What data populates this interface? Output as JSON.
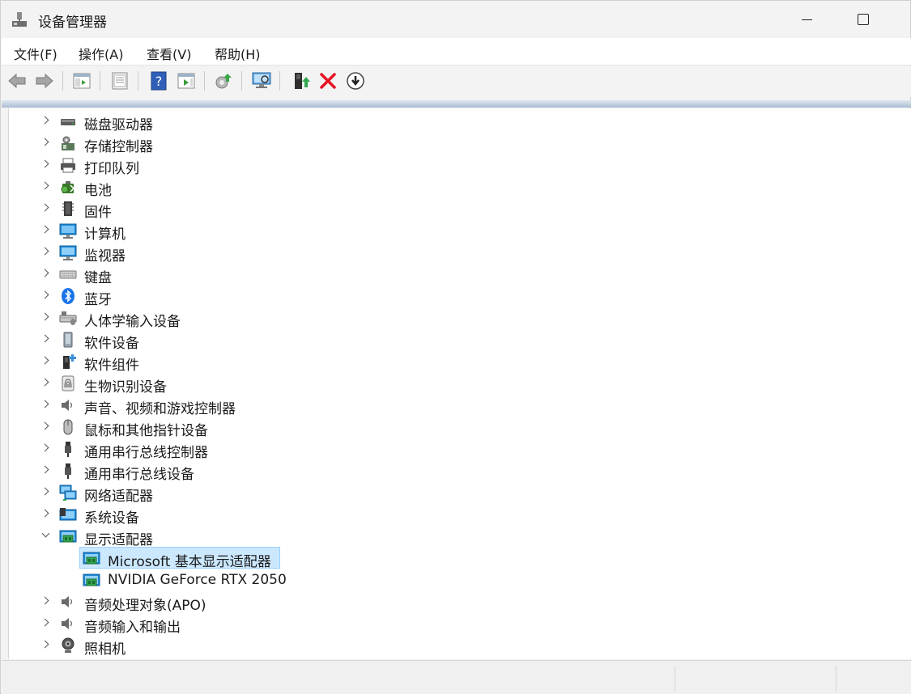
{
  "window": {
    "title": "设备管理器",
    "icon": "device-manager-icon"
  },
  "menu": [
    {
      "label": "文件(F)"
    },
    {
      "label": "操作(A)"
    },
    {
      "label": "查看(V)"
    },
    {
      "label": "帮助(H)"
    }
  ],
  "toolbar": [
    {
      "icon": "back-arrow-icon"
    },
    {
      "icon": "forward-arrow-icon"
    },
    {
      "icon": "show-hide-console-tree-icon"
    },
    {
      "icon": "properties-icon"
    },
    {
      "icon": "help-icon"
    },
    {
      "icon": "run-icon"
    },
    {
      "icon": "update-driver-icon"
    },
    {
      "icon": "scan-hardware-icon"
    },
    {
      "icon": "enable-device-icon"
    },
    {
      "icon": "uninstall-device-icon"
    },
    {
      "icon": "disable-device-icon"
    }
  ],
  "tree": {
    "items": [
      {
        "label": "磁盘驱动器",
        "icon": "disk-drive-icon",
        "expanded": false
      },
      {
        "label": "存储控制器",
        "icon": "storage-controller-icon",
        "expanded": false
      },
      {
        "label": "打印队列",
        "icon": "printer-icon",
        "expanded": false
      },
      {
        "label": "电池",
        "icon": "battery-icon",
        "expanded": false
      },
      {
        "label": "固件",
        "icon": "firmware-icon",
        "expanded": false
      },
      {
        "label": "计算机",
        "icon": "computer-icon",
        "expanded": false
      },
      {
        "label": "监视器",
        "icon": "monitor-icon",
        "expanded": false
      },
      {
        "label": "键盘",
        "icon": "keyboard-icon",
        "expanded": false
      },
      {
        "label": "蓝牙",
        "icon": "bluetooth-icon",
        "expanded": false
      },
      {
        "label": "人体学输入设备",
        "icon": "hid-icon",
        "expanded": false
      },
      {
        "label": "软件设备",
        "icon": "software-device-icon",
        "expanded": false
      },
      {
        "label": "软件组件",
        "icon": "software-component-icon",
        "expanded": false
      },
      {
        "label": "生物识别设备",
        "icon": "fingerprint-icon",
        "expanded": false
      },
      {
        "label": "声音、视频和游戏控制器",
        "icon": "speaker-icon",
        "expanded": false
      },
      {
        "label": "鼠标和其他指针设备",
        "icon": "mouse-icon",
        "expanded": false
      },
      {
        "label": "通用串行总线控制器",
        "icon": "usb-icon",
        "expanded": false
      },
      {
        "label": "通用串行总线设备",
        "icon": "usb-icon",
        "expanded": false
      },
      {
        "label": "网络适配器",
        "icon": "network-adapter-icon",
        "expanded": false
      },
      {
        "label": "系统设备",
        "icon": "system-device-icon",
        "expanded": false
      },
      {
        "label": "显示适配器",
        "icon": "display-adapter-icon",
        "expanded": true,
        "children": [
          {
            "label": "Microsoft 基本显示适配器",
            "icon": "display-adapter-icon",
            "selected": true
          },
          {
            "label": "NVIDIA GeForce RTX 2050",
            "icon": "display-adapter-icon",
            "selected": false
          }
        ]
      },
      {
        "label": "音频处理对象(APO)",
        "icon": "speaker-icon",
        "expanded": false
      },
      {
        "label": "音频输入和输出",
        "icon": "speaker-icon",
        "expanded": false
      },
      {
        "label": "照相机",
        "icon": "camera-icon",
        "expanded": false
      }
    ]
  },
  "colors": {
    "selection_bg": "#cce8ff",
    "selection_border": "#99d1ff",
    "accent_red": "#e81123",
    "accent_green": "#2fa84f",
    "monitor_blue": "#1e88d8"
  }
}
